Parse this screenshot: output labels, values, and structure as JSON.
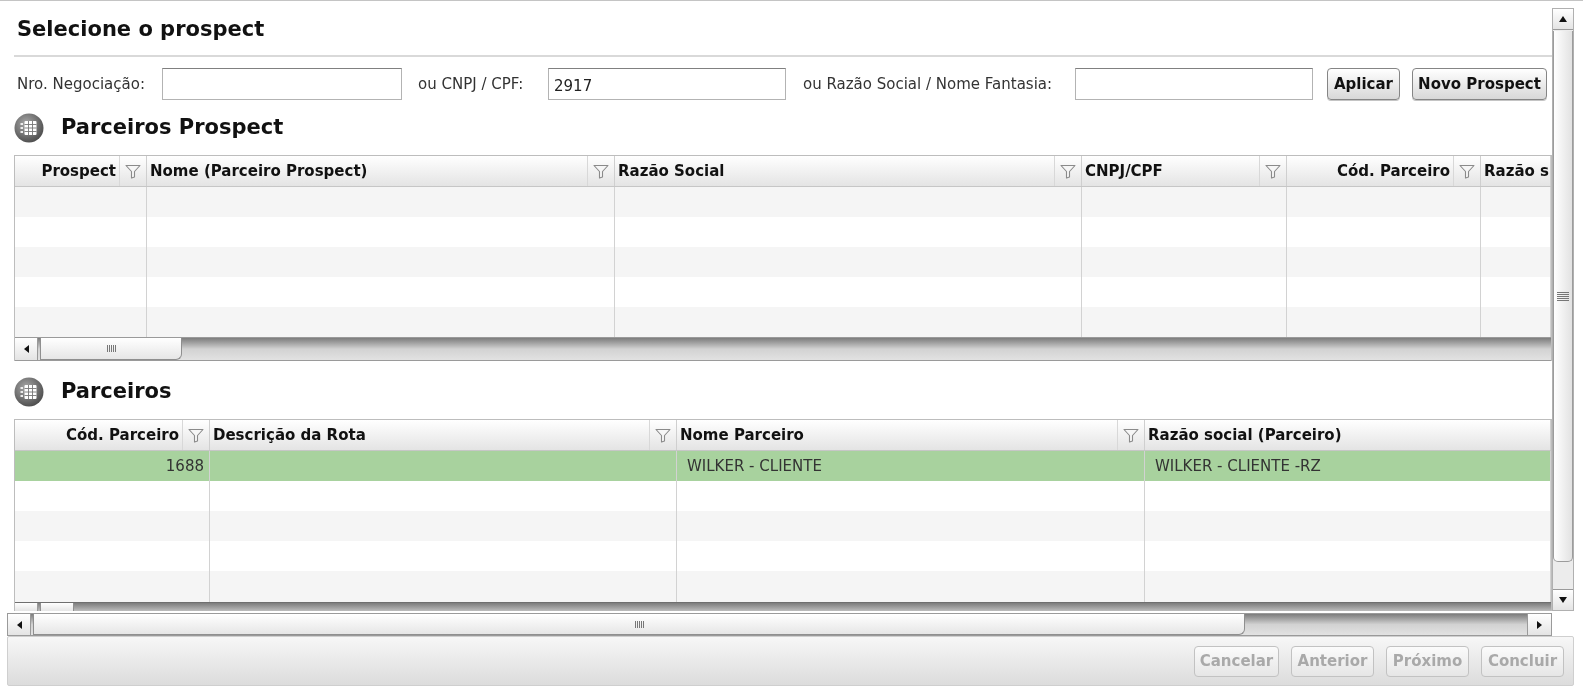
{
  "dialog": {
    "title": "Selecione o prospect"
  },
  "search": {
    "fields": [
      {
        "label": "Nro. Negociação:"
      },
      {
        "label": "ou CNPJ / CPF:",
        "value": "2917"
      },
      {
        "label": "ou Razão Social / Nome Fantasia:"
      }
    ],
    "buttons": [
      "Aplicar",
      "Novo Prospect"
    ]
  },
  "prospect_grid": {
    "title": "Parceiros Prospect",
    "columns": [
      {
        "label": "Prospect",
        "kind": "numeric",
        "filter": true
      },
      {
        "label": "Nome (Parceiro Prospect)",
        "kind": "text",
        "filter": true
      },
      {
        "label": "Razão Social",
        "kind": "text",
        "filter": true
      },
      {
        "label": "CNPJ/CPF",
        "kind": "text",
        "filter": true
      },
      {
        "label": "Cód. Parceiro",
        "kind": "numeric",
        "filter": true
      },
      {
        "label": "Razão s",
        "kind": "text",
        "filter": false
      }
    ]
  },
  "partner_grid": {
    "title": "Parceiros",
    "columns": [
      {
        "label": "Cód. Parceiro",
        "kind": "numeric",
        "filter": true
      },
      {
        "label": "Descrição da Rota",
        "kind": "text",
        "filter": true
      },
      {
        "label": "Nome Parceiro",
        "kind": "text",
        "filter": true
      },
      {
        "label": "Razão social (Parceiro)",
        "kind": "text",
        "filter": false
      }
    ],
    "rows": [
      {
        "selected": true,
        "cells": [
          "1688",
          null,
          "WILKER - CLIENTE",
          "WILKER - CLIENTE -RZ"
        ]
      }
    ]
  },
  "footer": {
    "buttons": [
      {
        "label": "Cancelar",
        "disabled": true
      },
      {
        "label": "Anterior",
        "disabled": true
      },
      {
        "label": "Próximo",
        "disabled": true
      },
      {
        "label": "Concluir",
        "disabled": true
      }
    ]
  }
}
